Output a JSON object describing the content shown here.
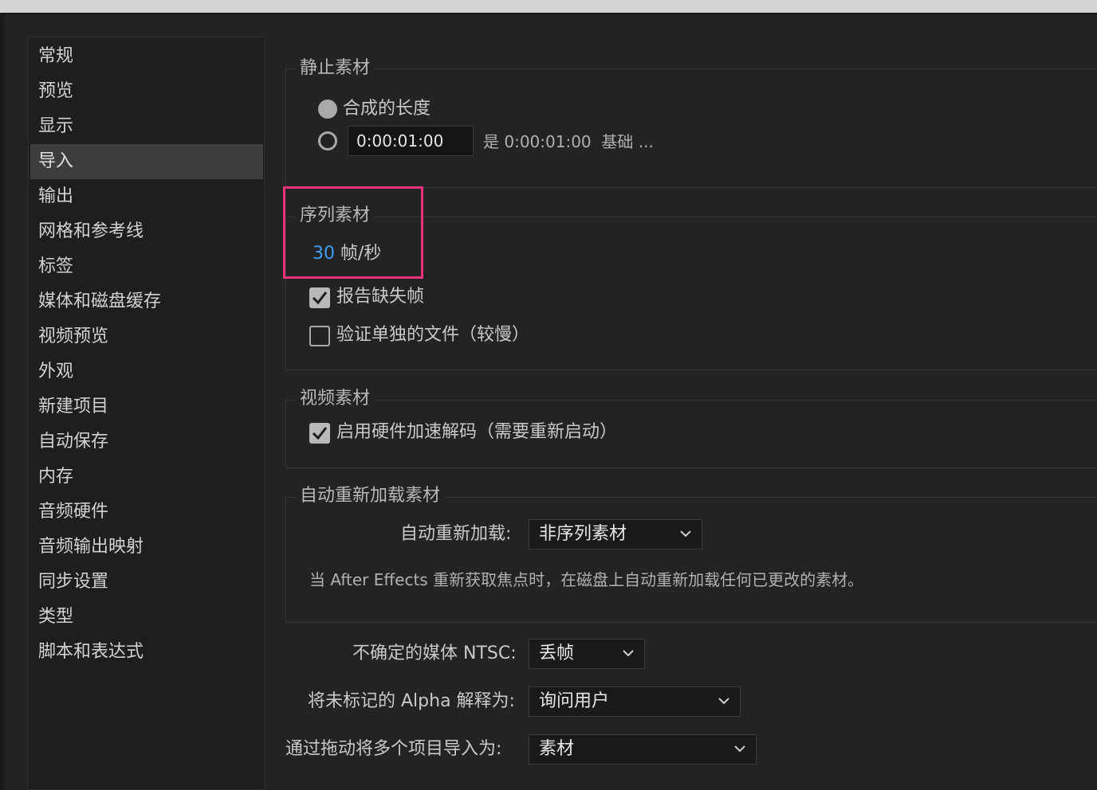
{
  "sidebar": {
    "items": [
      {
        "label": "常规"
      },
      {
        "label": "预览"
      },
      {
        "label": "显示"
      },
      {
        "label": "导入",
        "selected": true
      },
      {
        "label": "输出"
      },
      {
        "label": "网格和参考线"
      },
      {
        "label": "标签"
      },
      {
        "label": "媒体和磁盘缓存"
      },
      {
        "label": "视频预览"
      },
      {
        "label": "外观"
      },
      {
        "label": "新建项目"
      },
      {
        "label": "自动保存"
      },
      {
        "label": "内存"
      },
      {
        "label": "音频硬件"
      },
      {
        "label": "音频输出映射"
      },
      {
        "label": "同步设置"
      },
      {
        "label": "类型"
      },
      {
        "label": "脚本和表达式"
      }
    ]
  },
  "still_footage": {
    "title": "静止素材",
    "option_comp_length": "合成的长度",
    "duration_value": "0:00:01:00",
    "duration_note_prefix": "是 0:00:01:00",
    "duration_note_suffix": "基础 ..."
  },
  "sequence_footage": {
    "title": "序列素材",
    "fps_value": "30",
    "fps_unit": "帧/秒",
    "report_missing": "报告缺失帧",
    "report_missing_checked": true,
    "verify_files": "验证单独的文件（较慢）",
    "verify_files_checked": false
  },
  "video_footage": {
    "title": "视频素材",
    "hw_decode": "启用硬件加速解码（需要重新启动）",
    "hw_decode_checked": true
  },
  "auto_reload": {
    "title": "自动重新加载素材",
    "label": "自动重新加载:",
    "value": "非序列素材",
    "description": "当 After Effects 重新获取焦点时，在磁盘上自动重新加载任何已更改的素材。"
  },
  "ntsc": {
    "label": "不确定的媒体 NTSC:",
    "value": "丢帧"
  },
  "alpha": {
    "label": "将未标记的 Alpha 解释为:",
    "value": "询问用户"
  },
  "drag_import": {
    "label": "通过拖动将多个项目导入为:",
    "value": "素材"
  },
  "colors": {
    "accent_link": "#3f9df5",
    "highlight_box": "#e8317a",
    "selected_item": "#3d3d3d"
  }
}
